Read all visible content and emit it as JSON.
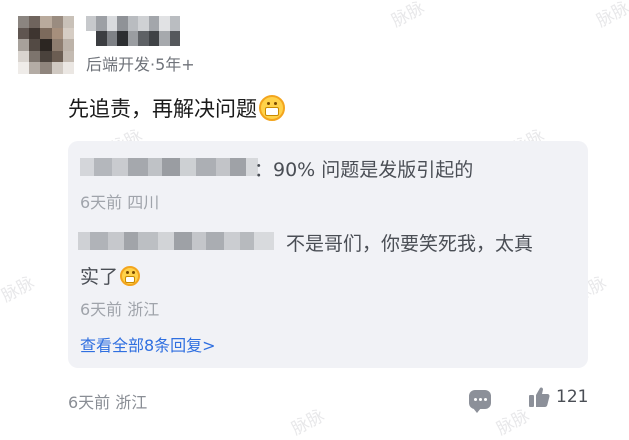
{
  "post": {
    "author_meta": "后端开发·5年+",
    "comment_text": "先追责，再解决问题",
    "comment_emoji": "grinning-emoji"
  },
  "replies": [
    {
      "text": "：90% 问题是发版引起的",
      "meta": "6天前 四川"
    },
    {
      "text": "不是哥们，你要笑死我，太真",
      "text_line2": "实了",
      "emoji": "grinning-emoji",
      "meta": "6天前 浙江"
    }
  ],
  "view_all_label": "查看全部8条回复>",
  "footer": {
    "meta": "6天前 浙江",
    "reply_icon": "comment-bubble-icon",
    "like_icon": "thumbs-up-icon",
    "like_count": "121"
  },
  "watermark_text": "脉脉",
  "colors": {
    "reply_box_bg": "#f1f2f6",
    "link": "#2f6fe0",
    "meta_gray": "#a0a4ab"
  }
}
